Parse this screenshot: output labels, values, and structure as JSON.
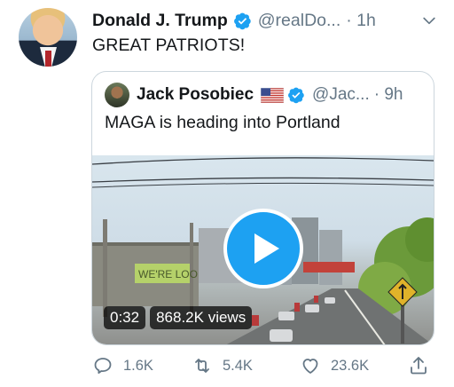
{
  "tweet": {
    "author_name": "Donald J. Trump",
    "author_handle": "@realDo...",
    "time": "· 1h",
    "text": "GREAT PATRIOTS!",
    "avatar_icon": "profile-photo"
  },
  "quoted_tweet": {
    "author_name": "Jack Posobiec",
    "author_handle": "@Jac...",
    "time": "· 9h",
    "text": "MAGA is heading into Portland",
    "video": {
      "duration": "0:32",
      "views": "868.2K views",
      "sign_text": "WE'RE LOO"
    }
  },
  "actions": {
    "reply_count": "1.6K",
    "retweet_count": "5.4K",
    "like_count": "23.6K"
  },
  "colors": {
    "accent": "#1da1f2",
    "secondary_text": "#657786",
    "border": "#ccd6dd"
  }
}
